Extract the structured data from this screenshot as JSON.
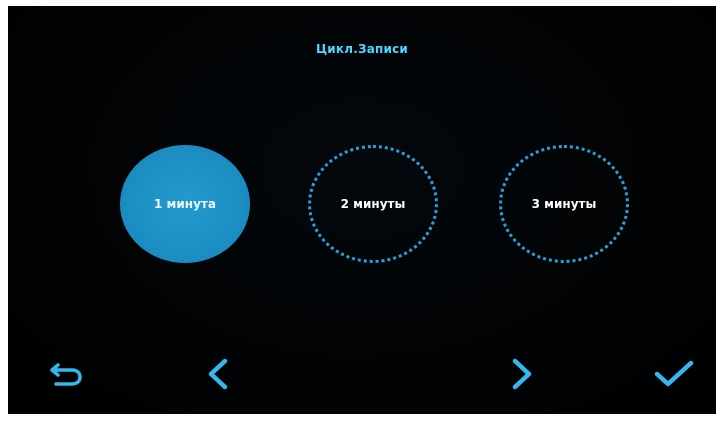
{
  "screen": {
    "title": "Цикл.Записи"
  },
  "options": [
    {
      "label": "1 минута",
      "selected": true
    },
    {
      "label": "2 минуты",
      "selected": false
    },
    {
      "label": "3 минуты",
      "selected": false
    }
  ],
  "nav": {
    "back_icon": "return-arrow-icon",
    "prev_icon": "chevron-left-icon",
    "next_icon": "chevron-right-icon",
    "confirm_icon": "checkmark-icon"
  },
  "colors": {
    "accent": "#4fd6ff",
    "selected_fill": "#1d8fc4",
    "dotted_ring": "#2a9fd8",
    "background": "#000000"
  }
}
